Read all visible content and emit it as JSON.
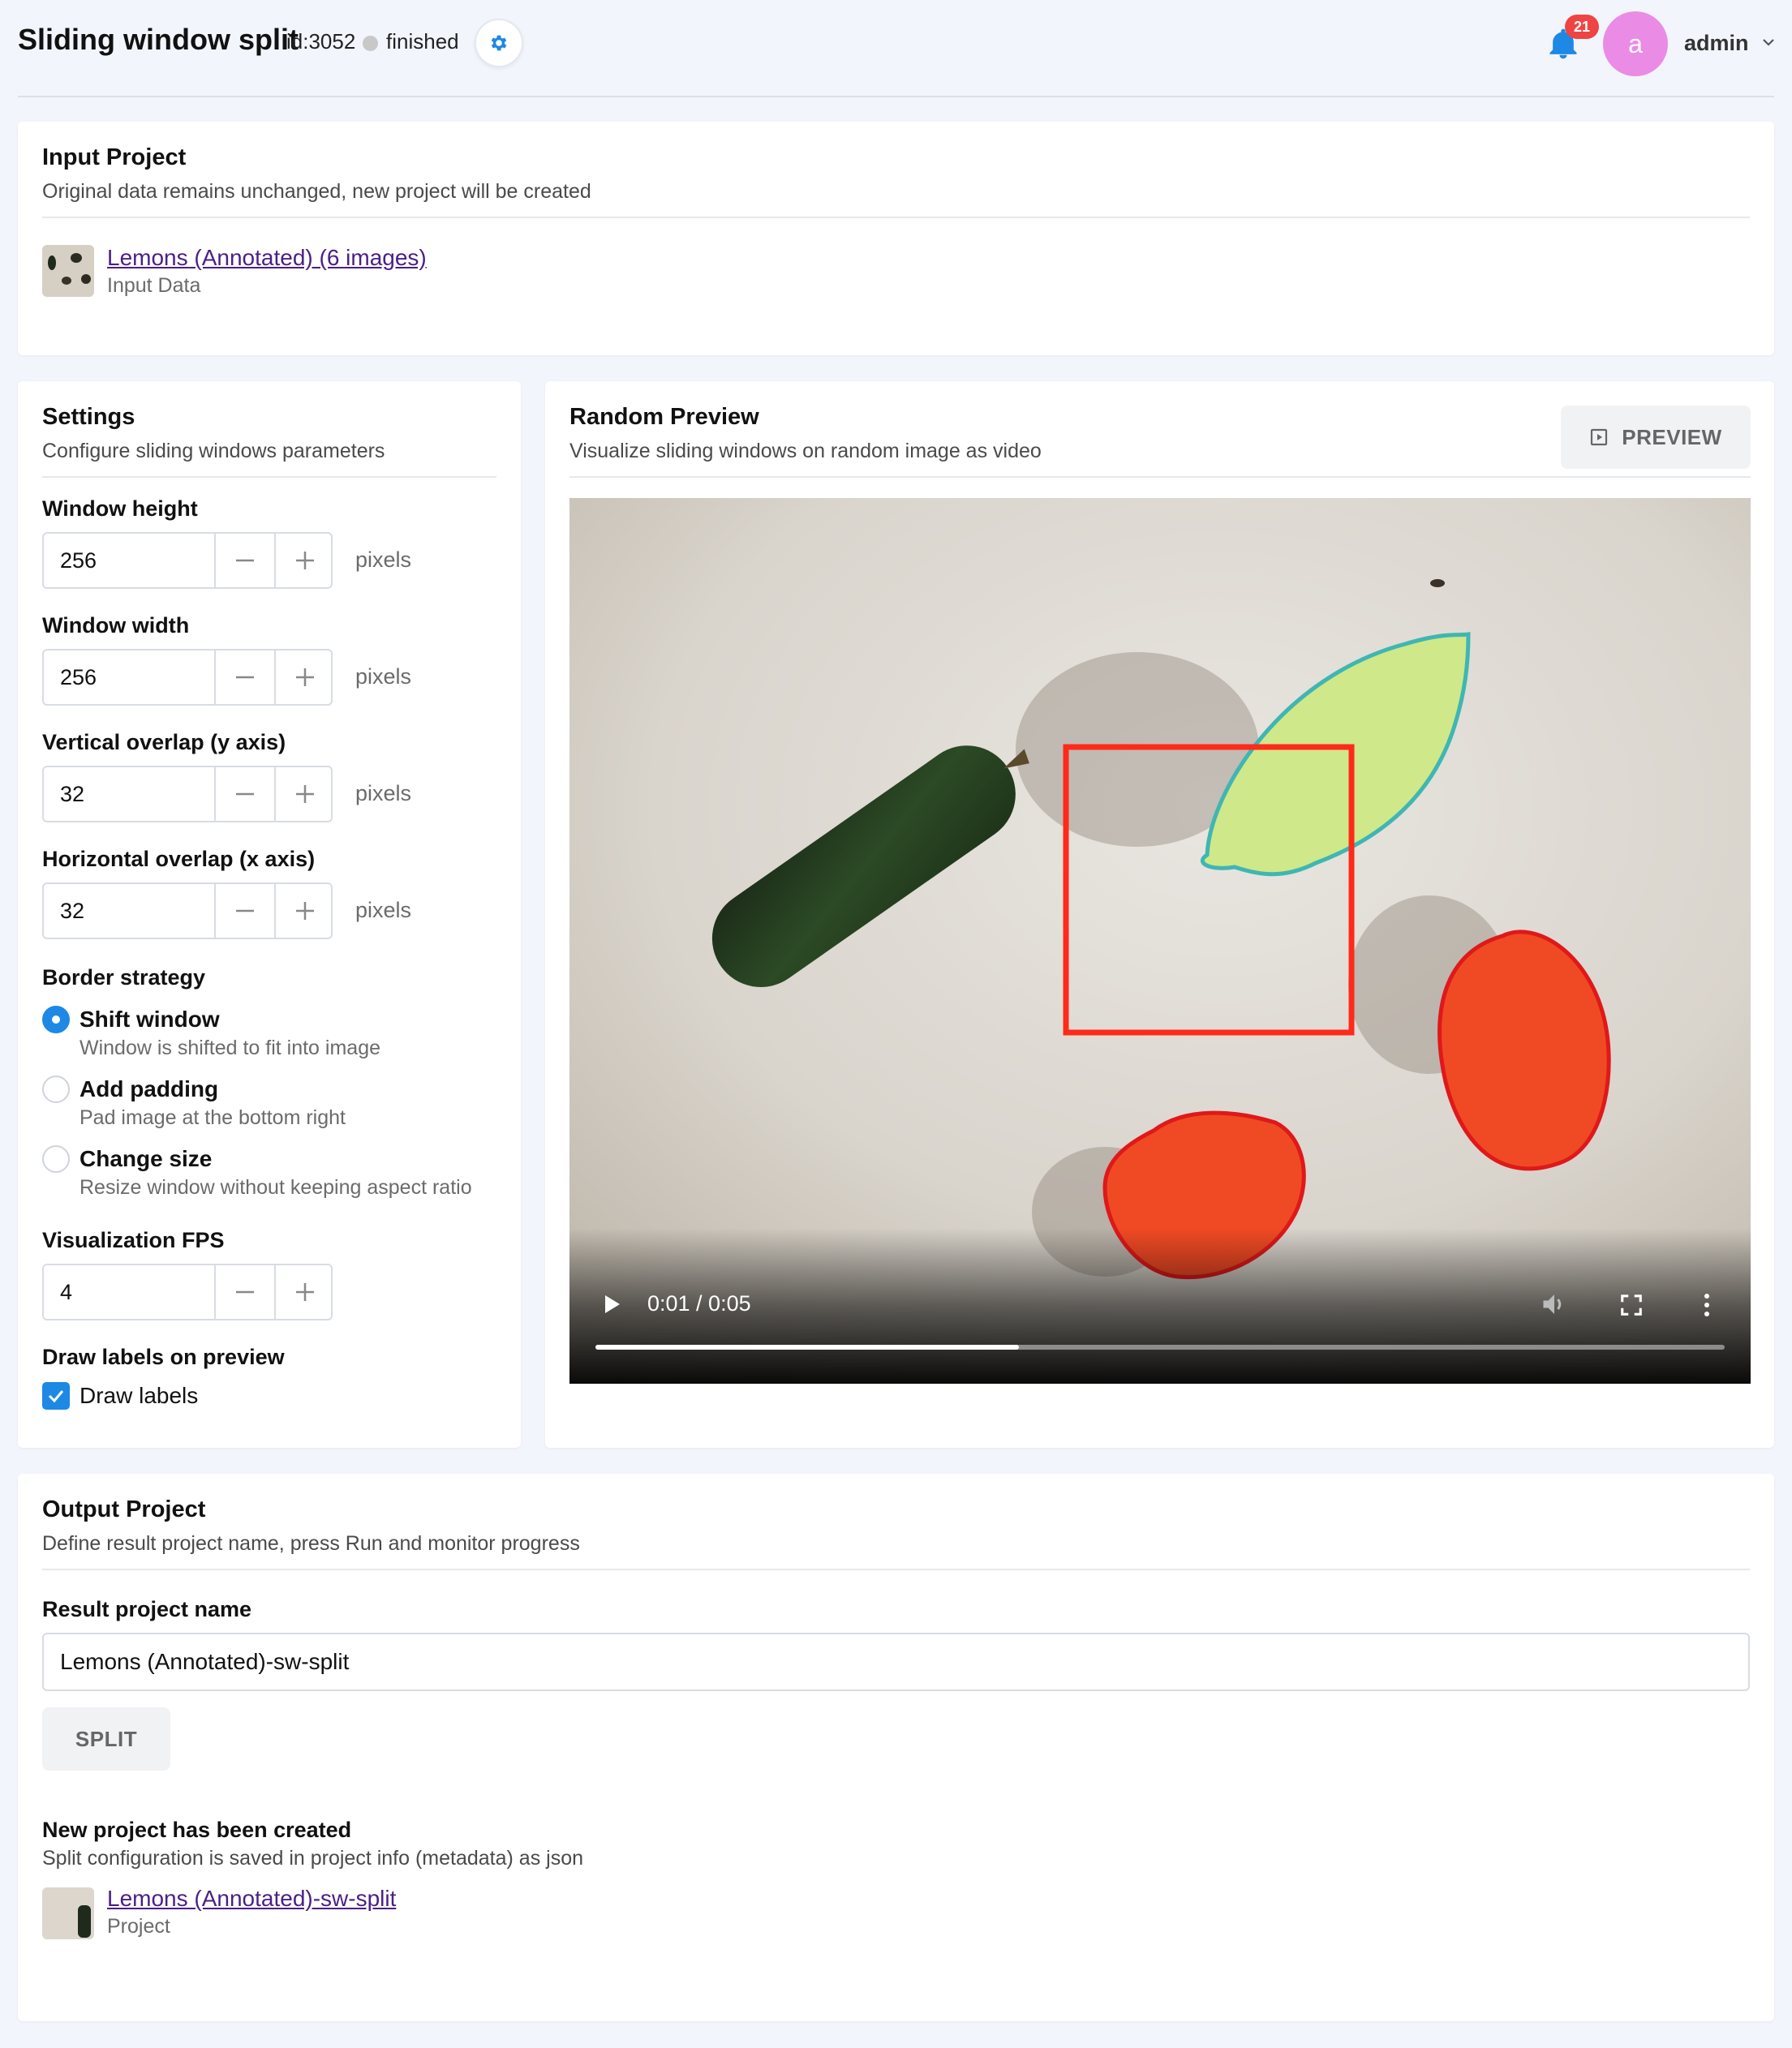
{
  "header": {
    "title": "Sliding window split",
    "app_id": "id:3052",
    "status": "finished",
    "notifications_count": "21",
    "avatar_letter": "a",
    "user_name": "admin"
  },
  "input_project": {
    "title": "Input Project",
    "subtitle": "Original data remains unchanged, new project will be created",
    "project_link": "Lemons (Annotated) (6 images)",
    "project_caption": "Input Data"
  },
  "settings": {
    "title": "Settings",
    "subtitle": "Configure sliding windows parameters",
    "fields": [
      {
        "label": "Window height",
        "value": "256",
        "unit": "pixels"
      },
      {
        "label": "Window width",
        "value": "256",
        "unit": "pixels"
      },
      {
        "label": "Vertical overlap (y axis)",
        "value": "32",
        "unit": "pixels"
      },
      {
        "label": "Horizontal overlap (x axis)",
        "value": "32",
        "unit": "pixels"
      }
    ],
    "border_strategy": {
      "label": "Border strategy",
      "selected": "Shift window",
      "options": [
        {
          "label": "Shift window",
          "desc": "Window is shifted to fit into image"
        },
        {
          "label": "Add padding",
          "desc": "Pad image at the bottom right"
        },
        {
          "label": "Change size",
          "desc": "Resize window without keeping aspect ratio"
        }
      ]
    },
    "fps": {
      "label": "Visualization FPS",
      "value": "4"
    },
    "draw_labels": {
      "label": "Draw labels on preview",
      "checkbox_label": "Draw labels",
      "checked": true
    }
  },
  "preview": {
    "title": "Random Preview",
    "subtitle": "Visualize sliding windows on random image as video",
    "button_label": "PREVIEW",
    "video": {
      "time": "0:01 / 0:05",
      "progress": 0.375
    }
  },
  "output_project": {
    "title": "Output Project",
    "subtitle": "Define result project name, press Run and monitor progress",
    "name_label": "Result project name",
    "name_value": "Lemons (Annotated)-sw-split",
    "split_button": "SPLIT",
    "created_title": "New project has been created",
    "created_subtitle": "Split configuration is saved in project info (metadata) as json",
    "created_link": "Lemons (Annotated)-sw-split",
    "created_caption": "Project"
  },
  "colors": {
    "accent": "#1e88e5",
    "link": "#4a1f86",
    "badge": "#ef4444",
    "avatar": "#ea8be6",
    "window_box": "#ff2a1a",
    "lemon_outline": "#3fb6b3",
    "tomato_outline": "#e0181a"
  }
}
